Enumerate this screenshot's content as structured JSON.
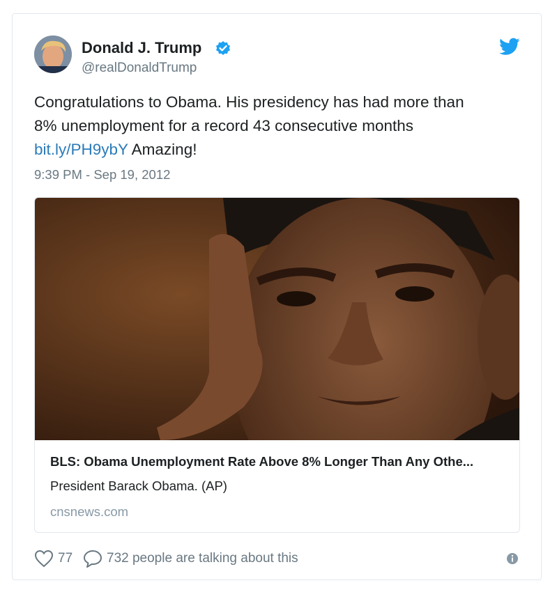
{
  "author": {
    "name": "Donald J. Trump",
    "handle": "@realDonaldTrump",
    "verified": true,
    "avatar_icon": "avatar-photo"
  },
  "tweet": {
    "text_line1": "Congratulations to Obama. His presidency has had more than",
    "text_line2": "8% unemployment for a record 43 consecutive months",
    "link": "bit.ly/PH9ybY",
    "text_after_link": " Amazing!",
    "timestamp": "9:39 PM - Sep 19, 2012"
  },
  "card": {
    "image_icon": "news-photo",
    "title": "BLS: Obama Unemployment Rate Above 8% Longer Than Any Othe...",
    "description": "President Barack Obama. (AP)",
    "domain": "cnsnews.com"
  },
  "actions": {
    "like_count": "77",
    "talking": "732 people are talking about this"
  },
  "colors": {
    "link": "#2b7bb9",
    "twitter_blue": "#1da1f2",
    "muted": "#697882",
    "border": "#e1e8ed"
  }
}
